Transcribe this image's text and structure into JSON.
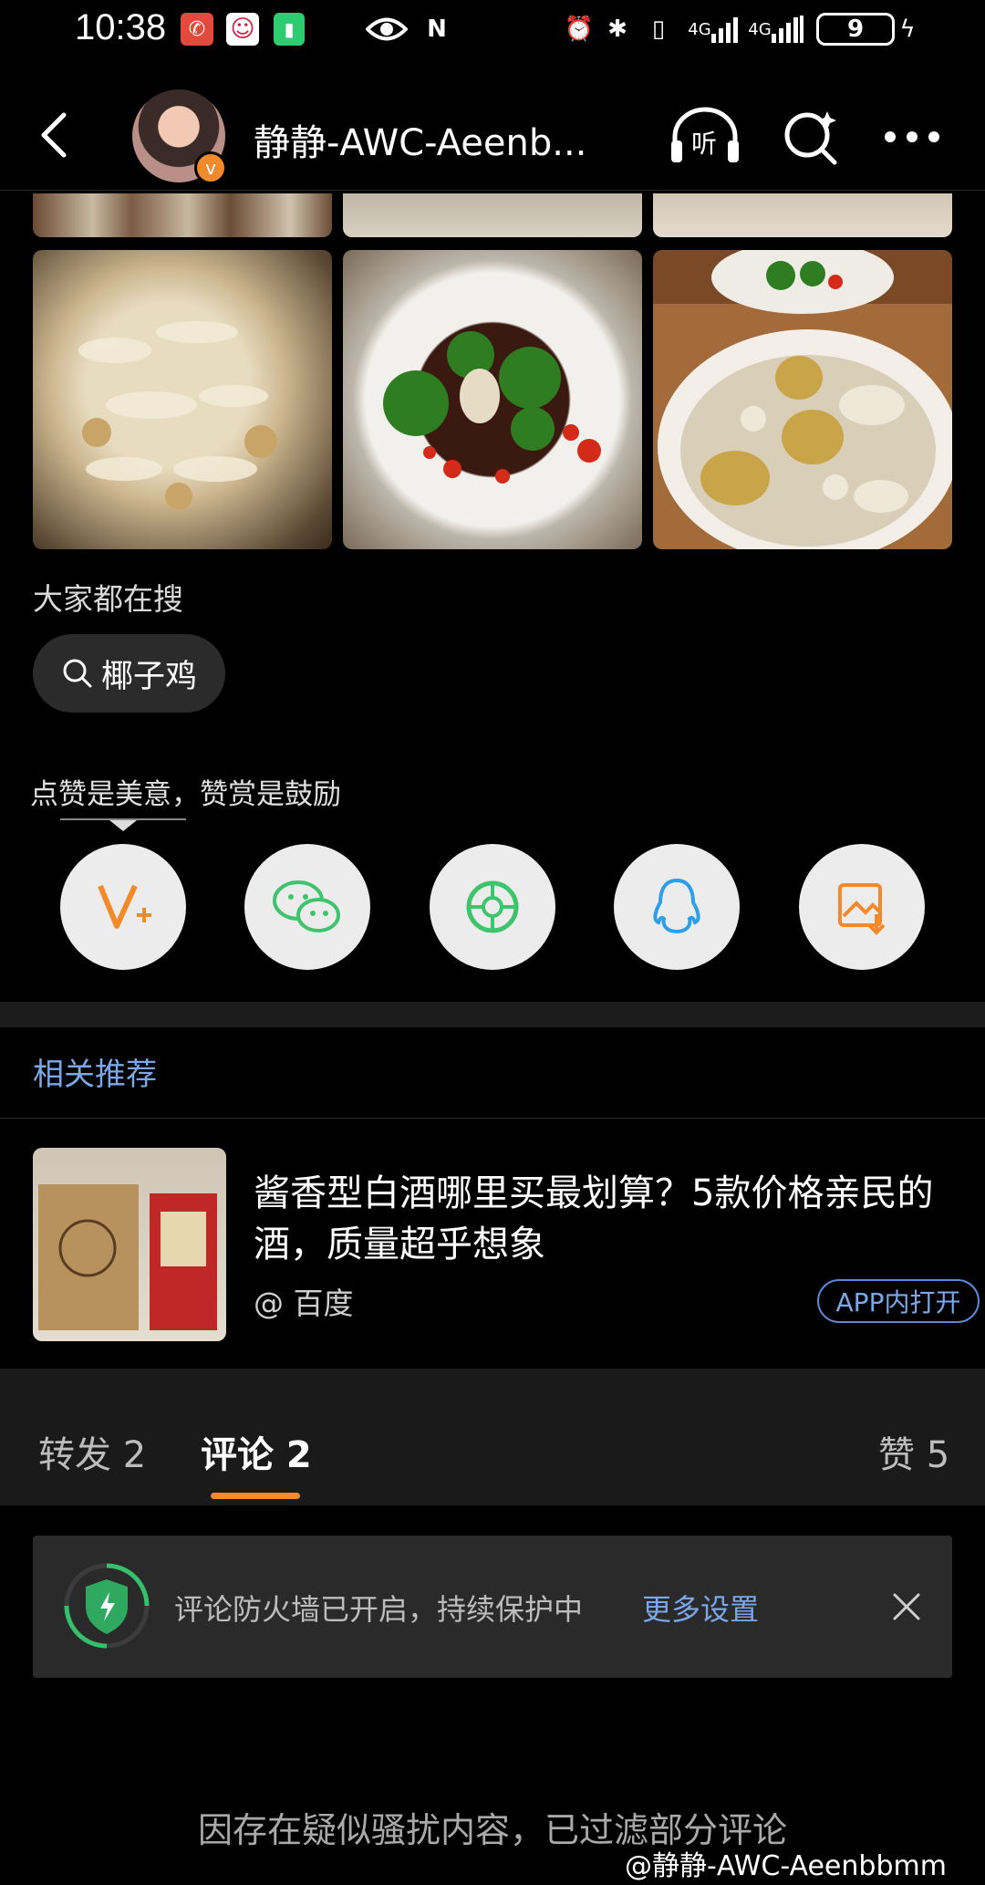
{
  "status_bar": {
    "time": "10:38",
    "network_1": "4G",
    "network_2": "4G",
    "battery": "9"
  },
  "header": {
    "title": "静静-AWC-Aeenb...",
    "verified_badge": "v",
    "listen_label": "听"
  },
  "search_section": {
    "label": "大家都在搜",
    "chip_text": "椰子鸡"
  },
  "reward_section": {
    "label": "点赞是美意，赞赏是鼓励"
  },
  "share_icons": [
    "vplus-icon",
    "wechat-icon",
    "moments-icon",
    "qq-icon",
    "save-image-icon"
  ],
  "related": {
    "title": "相关推荐",
    "item": {
      "title": "酱香型白酒哪里买最划算？5款价格亲民的酒，质量超乎想象",
      "source": "@ 百度",
      "open_button": "APP内打开"
    }
  },
  "tabs": {
    "repost": "转发 2",
    "comments": "评论 2",
    "likes": "赞 5"
  },
  "firewall": {
    "text": "评论防火墙已开启，持续保护中",
    "link": "更多设置"
  },
  "footer": {
    "filtered_text": "因存在疑似骚扰内容，已过滤部分评论",
    "watermark": "@静静-AWC-Aeenbbmm"
  },
  "colors": {
    "accent_orange": "#f08a2b",
    "link_blue": "#7aa8e8",
    "background": "#000000"
  }
}
